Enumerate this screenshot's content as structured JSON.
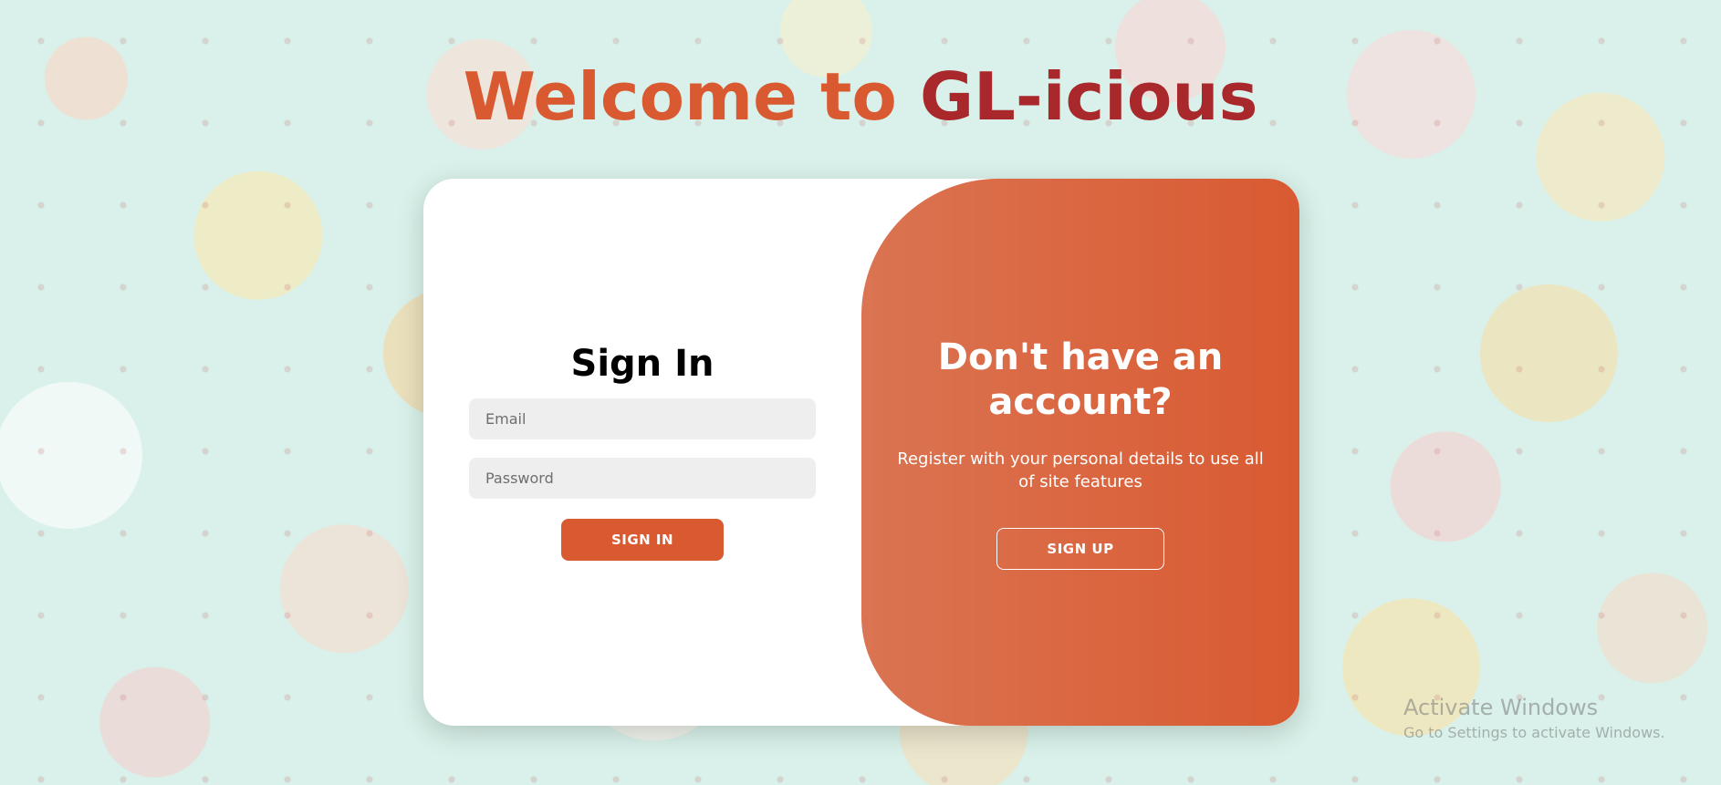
{
  "header": {
    "title_part1": "Welcome to",
    "title_part2": "GL-icious"
  },
  "sign_in": {
    "heading": "Sign In",
    "email_placeholder": "Email",
    "email_value": "",
    "password_placeholder": "Password",
    "password_value": "",
    "button_label": "SIGN IN"
  },
  "sign_up_panel": {
    "heading": "Don't have an account?",
    "description": "Register with your personal details to use all of site features",
    "button_label": "SIGN UP"
  },
  "os_watermark": {
    "line1": "Activate Windows",
    "line2": "Go to Settings to activate Windows."
  },
  "colors": {
    "brand_orange": "#d95a31",
    "brand_red": "#a8282b",
    "background": "#d9f1ea"
  }
}
